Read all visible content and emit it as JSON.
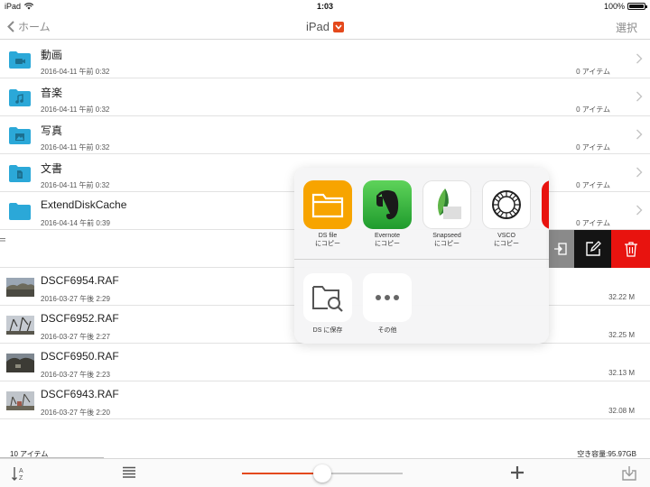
{
  "status_bar": {
    "carrier": "iPad",
    "time": "1:03",
    "battery": "100%"
  },
  "nav": {
    "back_label": "ホーム",
    "title": "iPad",
    "select_label": "選択"
  },
  "folders": [
    {
      "name": "動画",
      "date": "2016-04-11 午前 0:32",
      "items": "0 アイテム",
      "icon": "video-icon"
    },
    {
      "name": "音楽",
      "date": "2016-04-11 午前 0:32",
      "items": "0 アイテム",
      "icon": "music-icon"
    },
    {
      "name": "写真",
      "date": "2016-04-11 午前 0:32",
      "items": "0 アイテム",
      "icon": "photo-icon"
    },
    {
      "name": "文書",
      "date": "2016-04-11 午前 0:32",
      "items": "0 アイテム",
      "icon": "document-icon"
    },
    {
      "name": "ExtendDiskCache",
      "date": "2016-04-14 午前 0:39",
      "items": "0 アイテム",
      "icon": "folder-icon"
    }
  ],
  "files": [
    {
      "name": "DSCF6954.RAF",
      "date": "2016-03-27 午後 2:29",
      "size": "32.22 M"
    },
    {
      "name": "DSCF6952.RAF",
      "date": "2016-03-27 午後 2:27",
      "size": "32.25 M"
    },
    {
      "name": "DSCF6950.RAF",
      "date": "2016-03-27 午後 2:23",
      "size": "32.13 M"
    },
    {
      "name": "DSCF6943.RAF",
      "date": "2016-03-27 午後 2:20",
      "size": "32.08 M"
    }
  ],
  "share_sheet": {
    "apps": [
      {
        "line1": "DS file",
        "line2": "にコピー",
        "icon": "ds-file-icon"
      },
      {
        "line1": "Evernote",
        "line2": "にコピー",
        "icon": "evernote-icon"
      },
      {
        "line1": "Snapseed",
        "line2": "にコピー",
        "icon": "snapseed-icon"
      },
      {
        "line1": "VSCO",
        "line2": "にコピー",
        "icon": "vsco-icon"
      }
    ],
    "actions": [
      {
        "label": "DS に保存",
        "icon": "search-folder-icon"
      },
      {
        "label": "その他",
        "icon": "more-icon"
      }
    ]
  },
  "footer": {
    "item_count": "10 アイテム",
    "free_space": "空き容量:95.97GB"
  },
  "toolbar": {
    "zoom_level": 0.5
  },
  "colors": {
    "accent": "#e4491c",
    "folder": "#2ba8d8",
    "delete": "#e8130f"
  }
}
